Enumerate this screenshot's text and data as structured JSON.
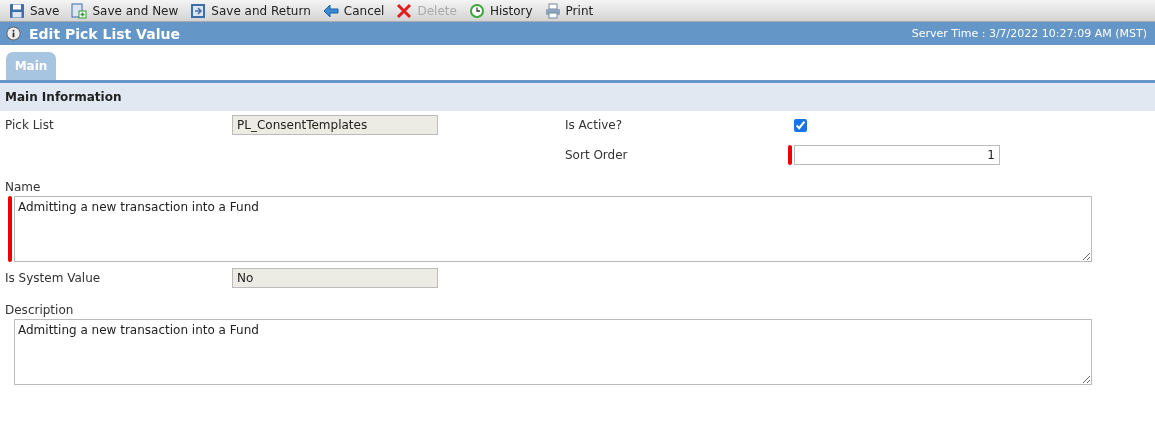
{
  "toolbar": [
    {
      "kind": "save",
      "label": "Save",
      "disabled": false
    },
    {
      "kind": "save-new",
      "label": "Save and New",
      "disabled": false
    },
    {
      "kind": "save-return",
      "label": "Save and Return",
      "disabled": false
    },
    {
      "kind": "cancel",
      "label": "Cancel",
      "disabled": false
    },
    {
      "kind": "delete",
      "label": "Delete",
      "disabled": true
    },
    {
      "kind": "history",
      "label": "History",
      "disabled": false
    },
    {
      "kind": "print",
      "label": "Print",
      "disabled": false
    }
  ],
  "title": "Edit Pick List Value",
  "server_time": "Server Time : 3/7/2022 10:27:09 AM (MST)",
  "tabs": [
    {
      "label": "Main",
      "selected": true
    }
  ],
  "section": "Main Information",
  "fields": {
    "pick_list": {
      "label": "Pick List",
      "value": "PL_ConsentTemplates",
      "readonly": true
    },
    "is_active": {
      "label": "Is Active?",
      "checked": true
    },
    "sort_order": {
      "label": "Sort Order",
      "value": "1",
      "required": true
    },
    "name": {
      "label": "Name",
      "value": "Admitting a new transaction into a Fund",
      "required": true
    },
    "is_system_value": {
      "label": "Is System Value",
      "value": "No",
      "readonly": true
    },
    "description": {
      "label": "Description",
      "value": "Admitting a new transaction into a Fund"
    }
  }
}
